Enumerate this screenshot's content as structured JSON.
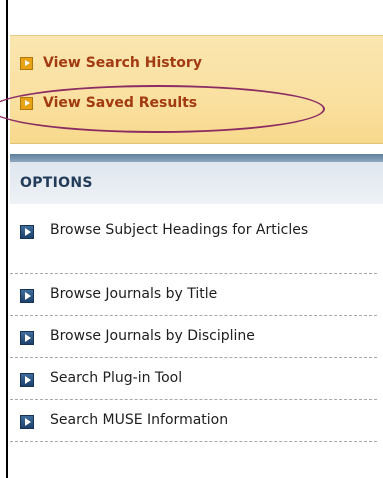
{
  "history": {
    "items": [
      {
        "label": "View Search History"
      },
      {
        "label": "View Saved Results"
      }
    ]
  },
  "options": {
    "header": "OPTIONS",
    "items": [
      {
        "label": "Browse Subject Headings for Articles"
      },
      {
        "label": "Browse Journals by Title"
      },
      {
        "label": "Browse Journals by Discipline"
      },
      {
        "label": "Search Plug-in Tool"
      },
      {
        "label": "Search MUSE Information"
      }
    ]
  },
  "colors": {
    "link_orange": "#a23a12",
    "panel_yellow": "#fae0a0",
    "header_navy": "#223c5a",
    "highlight_ellipse": "#8b2c63"
  }
}
